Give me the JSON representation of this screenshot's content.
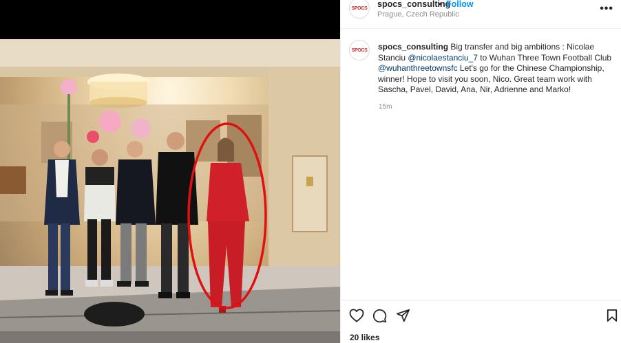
{
  "post": {
    "username": "spocs_consulting",
    "separator": "•",
    "follow_label": "Follow",
    "location": "Prague, Czech Republic",
    "more_label": "•••",
    "avatar_logo": "SPOCS"
  },
  "caption": {
    "username": "spocs_consulting",
    "text_1": " Big transfer and big ambitions : Nicolae Stanciu ",
    "mention_1": "@nicolaestanciu_7",
    "text_2": " to Wuhan Three Town Football Club ",
    "mention_2": "@wuhanthreetownsfc",
    "text_3": " Let's go for the Chinese Championship, winner! Hope to visit you soon, Nico. Great team work with Sascha, Pavel, David, Ana, Nir, Adrienne and Marko!",
    "time": "15m"
  },
  "actions": {
    "like_icon": "heart-icon",
    "comment_icon": "comment-icon",
    "share_icon": "share-icon",
    "save_icon": "bookmark-icon",
    "likes": "20 likes"
  },
  "colors": {
    "follow": "#0095f6",
    "mention": "#00376b",
    "secondary_text": "#8e8e8e",
    "highlight_circle": "#e01010",
    "red_suit": "#d0202a"
  }
}
